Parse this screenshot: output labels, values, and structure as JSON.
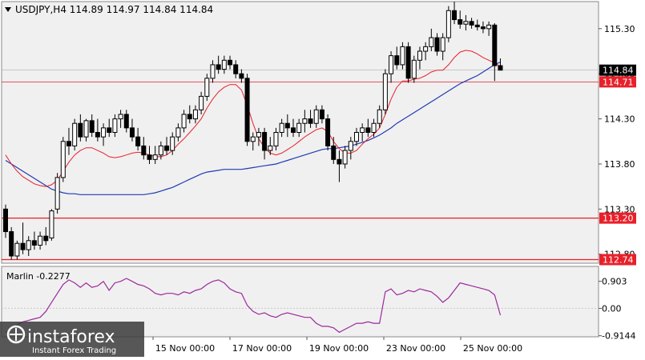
{
  "window": {
    "symbol_line": "USDJPY,H4  114.89 114.97 114.84 114.84",
    "indicator_label": "Marlin -0.2277",
    "watermark_brand": "instaforex",
    "watermark_tagline": "Instant Forex Trading"
  },
  "colors": {
    "background": "#ffffff",
    "plot_bg": "#f0f0f0",
    "candle": "#000000",
    "ma_fast": "#e8202a",
    "ma_slow": "#1f3bb3",
    "level_line": "#e8202a",
    "oscillator": "#9b2a9b",
    "price_tag_current": "#000000",
    "price_tag_level": "#e8202a"
  },
  "chart_data": [
    {
      "type": "candlestick",
      "ylim": [
        112.7,
        115.6
      ],
      "yticks": [
        "115.30",
        "114.80",
        "114.30",
        "113.80",
        "113.30",
        "112.80"
      ],
      "xticks": [
        "15 Nov 00:00",
        "17 Nov 00:00",
        "19 Nov 00:00",
        "23 Nov 00:00",
        "25 Nov 00:00"
      ],
      "candles": [
        [
          113.3,
          113.35,
          112.98,
          113.05
        ],
        [
          113.05,
          113.1,
          112.74,
          112.78
        ],
        [
          112.78,
          112.95,
          112.74,
          112.92
        ],
        [
          112.92,
          113.15,
          112.8,
          112.85
        ],
        [
          112.85,
          113.0,
          112.78,
          112.95
        ],
        [
          112.95,
          113.05,
          112.85,
          112.9
        ],
        [
          112.9,
          113.05,
          112.85,
          113.0
        ],
        [
          113.0,
          113.1,
          112.9,
          112.95
        ],
        [
          112.98,
          113.3,
          112.95,
          113.28
        ],
        [
          113.3,
          113.7,
          113.25,
          113.65
        ],
        [
          113.65,
          114.1,
          113.6,
          114.05
        ],
        [
          114.05,
          114.2,
          113.9,
          114.0
        ],
        [
          114.0,
          114.3,
          113.95,
          114.25
        ],
        [
          114.25,
          114.35,
          114.05,
          114.1
        ],
        [
          114.1,
          114.3,
          114.05,
          114.28
        ],
        [
          114.28,
          114.35,
          114.1,
          114.15
        ],
        [
          114.15,
          114.3,
          114.05,
          114.1
        ],
        [
          114.1,
          114.25,
          114.0,
          114.2
        ],
        [
          114.2,
          114.3,
          114.1,
          114.15
        ],
        [
          114.15,
          114.35,
          114.1,
          114.3
        ],
        [
          114.3,
          114.4,
          114.2,
          114.35
        ],
        [
          114.35,
          114.4,
          114.15,
          114.2
        ],
        [
          114.2,
          114.3,
          114.05,
          114.1
        ],
        [
          114.1,
          114.2,
          113.95,
          114.0
        ],
        [
          114.0,
          114.1,
          113.85,
          113.9
        ],
        [
          113.9,
          114.0,
          113.8,
          113.85
        ],
        [
          113.85,
          114.0,
          113.8,
          113.9
        ],
        [
          113.9,
          114.05,
          113.85,
          114.0
        ],
        [
          114.0,
          114.1,
          113.9,
          113.95
        ],
        [
          113.95,
          114.15,
          113.9,
          114.1
        ],
        [
          114.1,
          114.25,
          114.05,
          114.2
        ],
        [
          114.2,
          114.4,
          114.15,
          114.35
        ],
        [
          114.35,
          114.45,
          114.25,
          114.3
        ],
        [
          114.3,
          114.45,
          114.25,
          114.4
        ],
        [
          114.4,
          114.6,
          114.35,
          114.55
        ],
        [
          114.55,
          114.8,
          114.5,
          114.75
        ],
        [
          114.75,
          114.95,
          114.7,
          114.9
        ],
        [
          114.9,
          115.0,
          114.8,
          114.85
        ],
        [
          114.85,
          115.0,
          114.8,
          114.95
        ],
        [
          114.95,
          115.0,
          114.85,
          114.9
        ],
        [
          114.9,
          114.95,
          114.75,
          114.8
        ],
        [
          114.8,
          114.85,
          114.7,
          114.75
        ],
        [
          114.75,
          114.8,
          114.0,
          114.05
        ],
        [
          114.05,
          114.15,
          113.95,
          114.1
        ],
        [
          114.1,
          114.2,
          114.0,
          114.15
        ],
        [
          114.15,
          114.2,
          113.85,
          113.95
        ],
        [
          113.95,
          114.1,
          113.9,
          114.0
        ],
        [
          114.0,
          114.2,
          113.95,
          114.15
        ],
        [
          114.15,
          114.3,
          114.1,
          114.25
        ],
        [
          114.25,
          114.35,
          114.1,
          114.2
        ],
        [
          114.2,
          114.3,
          114.1,
          114.15
        ],
        [
          114.15,
          114.3,
          114.1,
          114.25
        ],
        [
          114.25,
          114.4,
          114.15,
          114.3
        ],
        [
          114.3,
          114.4,
          114.2,
          114.25
        ],
        [
          114.25,
          114.45,
          114.2,
          114.4
        ],
        [
          114.4,
          114.45,
          114.25,
          114.3
        ],
        [
          114.3,
          114.35,
          113.95,
          114.0
        ],
        [
          114.0,
          114.1,
          113.8,
          113.85
        ],
        [
          113.85,
          113.95,
          113.6,
          113.8
        ],
        [
          113.8,
          114.0,
          113.75,
          113.95
        ],
        [
          113.95,
          114.1,
          113.85,
          114.05
        ],
        [
          114.05,
          114.2,
          114.0,
          114.15
        ],
        [
          114.15,
          114.25,
          114.05,
          114.2
        ],
        [
          114.2,
          114.3,
          114.1,
          114.15
        ],
        [
          114.15,
          114.3,
          114.1,
          114.25
        ],
        [
          114.25,
          114.45,
          114.2,
          114.4
        ],
        [
          114.4,
          114.85,
          114.35,
          114.8
        ],
        [
          114.8,
          115.05,
          114.7,
          115.0
        ],
        [
          115.0,
          115.1,
          114.85,
          114.9
        ],
        [
          114.9,
          115.15,
          114.85,
          115.1
        ],
        [
          115.1,
          115.15,
          114.7,
          114.75
        ],
        [
          114.75,
          115.0,
          114.7,
          114.95
        ],
        [
          114.95,
          115.1,
          114.85,
          115.05
        ],
        [
          115.05,
          115.15,
          114.95,
          115.1
        ],
        [
          115.1,
          115.3,
          115.05,
          115.2
        ],
        [
          115.2,
          115.25,
          115.0,
          115.05
        ],
        [
          115.05,
          115.25,
          114.95,
          115.2
        ],
        [
          115.2,
          115.55,
          115.15,
          115.5
        ],
        [
          115.5,
          115.6,
          115.35,
          115.4
        ],
        [
          115.4,
          115.5,
          115.3,
          115.35
        ],
        [
          115.35,
          115.45,
          115.28,
          115.38
        ],
        [
          115.38,
          115.42,
          115.3,
          115.34
        ],
        [
          115.34,
          115.4,
          115.28,
          115.32
        ],
        [
          115.32,
          115.38,
          115.25,
          115.3
        ],
        [
          115.3,
          115.38,
          115.22,
          115.34
        ],
        [
          115.34,
          115.36,
          114.72,
          114.89
        ],
        [
          114.89,
          114.97,
          114.84,
          114.84
        ]
      ],
      "ma_fast": [
        113.9,
        113.8,
        113.72,
        113.66,
        113.62,
        113.58,
        113.56,
        113.55,
        113.57,
        113.62,
        113.72,
        113.82,
        113.9,
        113.95,
        113.98,
        113.98,
        113.95,
        113.92,
        113.88,
        113.87,
        113.88,
        113.9,
        113.92,
        113.93,
        113.92,
        113.9,
        113.88,
        113.88,
        113.9,
        113.95,
        114.02,
        114.08,
        114.15,
        114.22,
        114.3,
        114.42,
        114.52,
        114.6,
        114.65,
        114.68,
        114.68,
        114.62,
        114.45,
        114.25,
        114.08,
        113.98,
        113.92,
        113.9,
        113.92,
        113.96,
        114.0,
        114.05,
        114.1,
        114.14,
        114.18,
        114.2,
        114.16,
        114.05,
        113.97,
        113.92,
        113.92,
        113.95,
        114.02,
        114.08,
        114.13,
        114.2,
        114.35,
        114.52,
        114.65,
        114.72,
        114.72,
        114.74,
        114.75,
        114.78,
        114.82,
        114.84,
        114.84,
        114.9,
        114.98,
        115.04,
        115.06,
        115.05,
        115.02,
        114.98,
        114.95,
        114.92,
        114.88
      ],
      "ma_slow": [
        113.84,
        113.8,
        113.76,
        113.72,
        113.68,
        113.64,
        113.6,
        113.56,
        113.52,
        113.5,
        113.48,
        113.47,
        113.47,
        113.46,
        113.46,
        113.46,
        113.46,
        113.46,
        113.46,
        113.46,
        113.46,
        113.46,
        113.46,
        113.46,
        113.46,
        113.47,
        113.48,
        113.5,
        113.52,
        113.54,
        113.57,
        113.6,
        113.63,
        113.66,
        113.69,
        113.71,
        113.72,
        113.73,
        113.74,
        113.74,
        113.74,
        113.74,
        113.75,
        113.76,
        113.77,
        113.78,
        113.79,
        113.8,
        113.82,
        113.84,
        113.86,
        113.88,
        113.9,
        113.92,
        113.94,
        113.96,
        113.97,
        113.97,
        113.98,
        113.99,
        114.0,
        114.02,
        114.04,
        114.06,
        114.09,
        114.12,
        114.16,
        114.2,
        114.25,
        114.29,
        114.33,
        114.37,
        114.41,
        114.45,
        114.49,
        114.53,
        114.57,
        114.61,
        114.65,
        114.69,
        114.72,
        114.75,
        114.78,
        114.82,
        114.86,
        114.9,
        114.93
      ]
    },
    {
      "type": "line",
      "title": "Marlin -0.2277",
      "ylim": [
        -0.95,
        1.4
      ],
      "yticks": [
        "0.903",
        "0.00",
        "-0.9144"
      ],
      "series": [
        {
          "values": [
            -0.8,
            -0.7,
            -0.55,
            -0.45,
            -0.4,
            -0.35,
            -0.3,
            -0.1,
            0.2,
            0.5,
            0.8,
            0.95,
            0.85,
            0.7,
            0.85,
            0.7,
            0.75,
            0.9,
            0.6,
            0.85,
            0.9,
            1.0,
            0.9,
            0.8,
            0.75,
            0.65,
            0.5,
            0.45,
            0.5,
            0.5,
            0.45,
            0.55,
            0.5,
            0.6,
            0.65,
            0.8,
            0.9,
            0.95,
            0.85,
            0.65,
            0.55,
            0.5,
            0.1,
            -0.1,
            -0.2,
            -0.15,
            -0.25,
            -0.3,
            -0.2,
            -0.15,
            -0.2,
            -0.25,
            -0.3,
            -0.3,
            -0.5,
            -0.6,
            -0.6,
            -0.65,
            -0.8,
            -0.7,
            -0.6,
            -0.5,
            -0.5,
            -0.45,
            -0.5,
            -0.5,
            0.55,
            0.65,
            0.45,
            0.5,
            0.6,
            0.55,
            0.65,
            0.6,
            0.55,
            0.4,
            0.2,
            0.35,
            0.6,
            0.85,
            0.8,
            0.75,
            0.7,
            0.65,
            0.6,
            0.45,
            -0.23
          ]
        }
      ]
    }
  ],
  "levels": [
    {
      "label": "114.71",
      "value": 114.71,
      "style": "thin"
    },
    {
      "label": "113.20",
      "value": 113.2,
      "style": "thick"
    },
    {
      "label": "112.74",
      "value": 112.74,
      "style": "thick"
    }
  ],
  "current_price": {
    "label": "114.84",
    "value": 114.84
  }
}
